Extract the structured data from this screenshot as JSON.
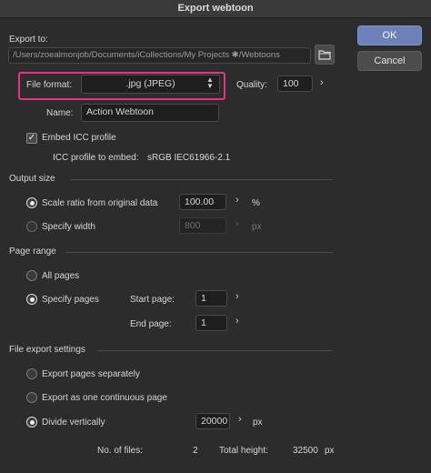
{
  "window": {
    "title": "Export webtoon"
  },
  "export_to": {
    "label": "Export to:",
    "path": "/Users/zoealmonjob/Documents/iCollections/My Projects ✱/Webtoons"
  },
  "buttons": {
    "ok": "OK",
    "cancel": "Cancel"
  },
  "file_format": {
    "label": "File format:",
    "value": ".jpg (JPEG)"
  },
  "quality": {
    "label": "Quality:",
    "value": "100"
  },
  "name": {
    "label": "Name:",
    "value": "Action Webtoon"
  },
  "icc": {
    "embed_label": "Embed ICC profile",
    "embed_checked": true,
    "profile_label": "ICC profile to embed:",
    "profile_value": "sRGB IEC61966-2.1"
  },
  "output_size": {
    "title": "Output size",
    "scale_label": "Scale ratio from original data",
    "scale_value": "100.00",
    "scale_unit": "%",
    "width_label": "Specify width",
    "width_value": "800",
    "width_unit": "px",
    "selected": "scale"
  },
  "page_range": {
    "title": "Page range",
    "all_label": "All pages",
    "specify_label": "Specify pages",
    "start_label": "Start page:",
    "start_value": "1",
    "end_label": "End page:",
    "end_value": "1",
    "selected": "specify"
  },
  "file_export": {
    "title": "File export settings",
    "separately_label": "Export pages separately",
    "continuous_label": "Export as one continuous page",
    "divide_label": "Divide vertically",
    "divide_value": "20000",
    "divide_unit": "px",
    "selected": "divide"
  },
  "summary": {
    "files_label": "No. of files:",
    "files_value": "2",
    "height_label": "Total height:",
    "height_value": "32500",
    "height_unit": "px"
  },
  "colors": {
    "accent_button": "#6b81b8",
    "highlight_box": "#e8347f"
  },
  "icons": {
    "folder": "folder-icon",
    "chevron": "chevron-right-icon",
    "updown": "updown-arrows-icon",
    "check": "checkmark-icon"
  }
}
